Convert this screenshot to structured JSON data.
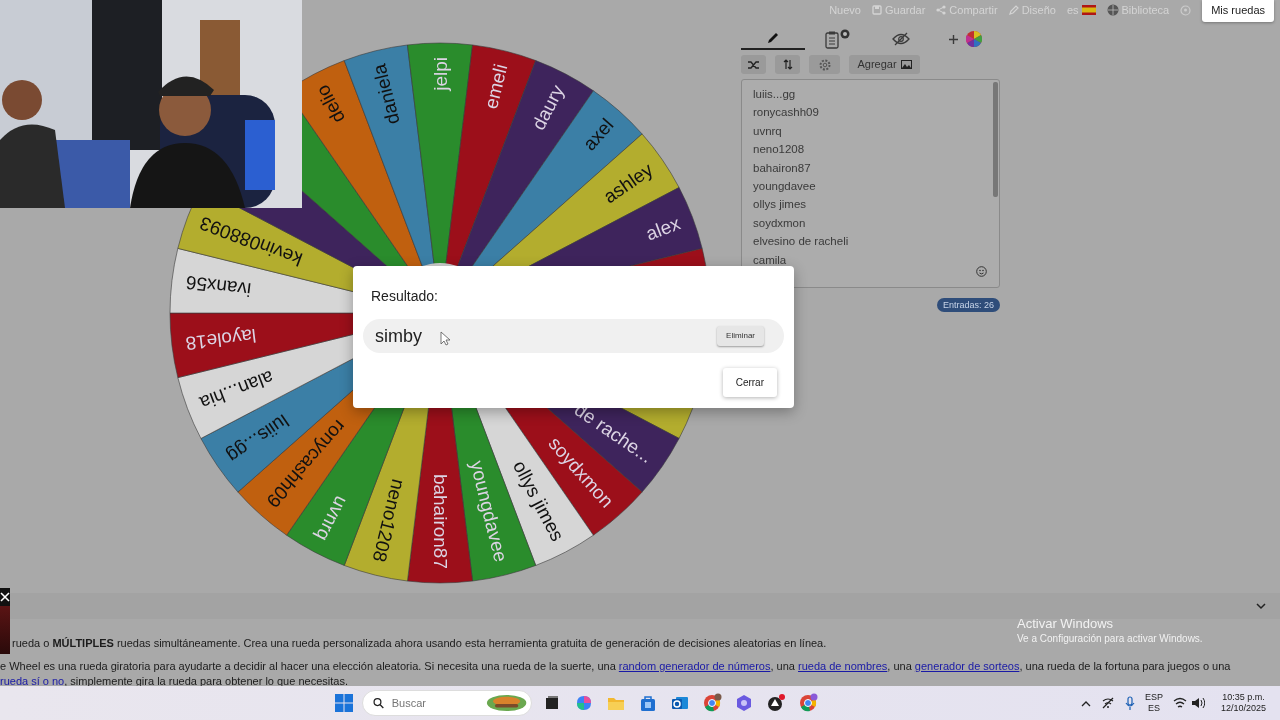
{
  "top_nav": {
    "items": [
      {
        "kind": "plain",
        "label": "Nuevo"
      },
      {
        "kind": "save",
        "label": "Guardar"
      },
      {
        "kind": "share",
        "label": "Compartir"
      },
      {
        "kind": "design",
        "label": "Diseño"
      },
      {
        "kind": "language",
        "label": "es"
      },
      {
        "kind": "library",
        "label": "Biblioteca"
      }
    ],
    "my_wheels_button": "Mis ruedas"
  },
  "wheel": {
    "segments": [
      {
        "color": "#b3ad2e"
      },
      {
        "label": "de rache...",
        "color": "#3e245c"
      },
      {
        "label": "soydxmon",
        "color": "#9c0f1a"
      },
      {
        "label": "ollys jimes",
        "color": "#d6d6d6"
      },
      {
        "label": "youngdavee",
        "color": "#2a8c2c"
      },
      {
        "label": "bahairon87",
        "color": "#9c0f1a"
      },
      {
        "label": "neno1208",
        "color": "#b3ad2e"
      },
      {
        "label": "uvnrq",
        "color": "#2a8c2c"
      },
      {
        "label": "ronycashh09",
        "color": "#c0600f"
      },
      {
        "label": "luiis...gg",
        "color": "#3b7fa6"
      },
      {
        "label": "alan...hia",
        "color": "#d6d6d6"
      },
      {
        "label": "layole18",
        "color": "#9c0f1a"
      },
      {
        "label": "ivanx56",
        "color": "#d6d6d6"
      },
      {
        "label": "kevin088093",
        "color": "#b3ad2e"
      },
      {
        "color": "#3e245c"
      },
      {
        "color": "#2a8c2c"
      },
      {
        "label": "delio",
        "color": "#c0600f"
      },
      {
        "label": "daniela",
        "color": "#3b7fa6"
      },
      {
        "label": "jelpi",
        "color": "#2a8c2c"
      },
      {
        "label": "emeli",
        "color": "#9c0f1a"
      },
      {
        "label": "daury",
        "color": "#3e245c"
      },
      {
        "label": "axel",
        "color": "#3b7fa6"
      },
      {
        "label": "ashley",
        "color": "#b3ad2e"
      },
      {
        "label": "alex",
        "color": "#3e245c"
      },
      {
        "color": "#9c0f1a"
      }
    ]
  },
  "editor": {
    "tabs": [
      {
        "kind": "edit",
        "selected": true
      },
      {
        "kind": "results",
        "selected": false
      },
      {
        "kind": "hide",
        "selected": false
      },
      {
        "kind": "add-wheel",
        "selected": false
      }
    ],
    "toolbar": {
      "add_button": "Agregar"
    },
    "entries": [
      "luiis...gg",
      "ronycashh09",
      "uvnrq",
      "neno1208",
      "bahairon87",
      "youngdavee",
      "ollys jimes",
      "soydxmon",
      "elvesino de racheli",
      "camila"
    ],
    "entry_count": "Entradas: 26"
  },
  "modal": {
    "title": "Resultado:",
    "result": "simby",
    "remove_button": "Eliminar",
    "close_button": "Cerrar"
  },
  "description": {
    "paragraphs": [
      {
        "lines": [
          [
            {
              "kind": "text",
              "text": "rueda o **MÚLTIPLES** ruedas simultáneamente. Crea una rueda personalizada ahora usando esta herramienta gratuita de generación de decisiones aleatorias en línea."
            }
          ]
        ]
      },
      {
        "lines": [
          [
            {
              "kind": "text",
              "text": "e Wheel es una rueda giratoria para ayudarte a decidir al hacer una elección aleatoria. Si necesita una rueda de la suerte, una "
            },
            {
              "kind": "link",
              "text": "random generador de números"
            },
            {
              "kind": "text",
              "text": ", una "
            },
            {
              "kind": "link",
              "text": "rueda de nombres"
            },
            {
              "kind": "text",
              "text": ", una "
            },
            {
              "kind": "link",
              "text": "generador de sorteos"
            },
            {
              "kind": "text",
              "text": ", una rueda de la fortuna para juegos o una"
            }
          ],
          [
            {
              "kind": "link",
              "text": "rueda sí o no"
            },
            {
              "kind": "text",
              "text": ", simplemente gira la rueda para obtener lo que necesitas."
            }
          ]
        ]
      }
    ]
  },
  "activation_notice": {
    "title": "Activar Windows",
    "text": "Ve a Configuración para activar Windows."
  },
  "taskbar": {
    "search_placeholder": "Buscar",
    "language": "ESP",
    "layout": "ES",
    "time": "10:35 p.m.",
    "date": "12/10/2025"
  }
}
